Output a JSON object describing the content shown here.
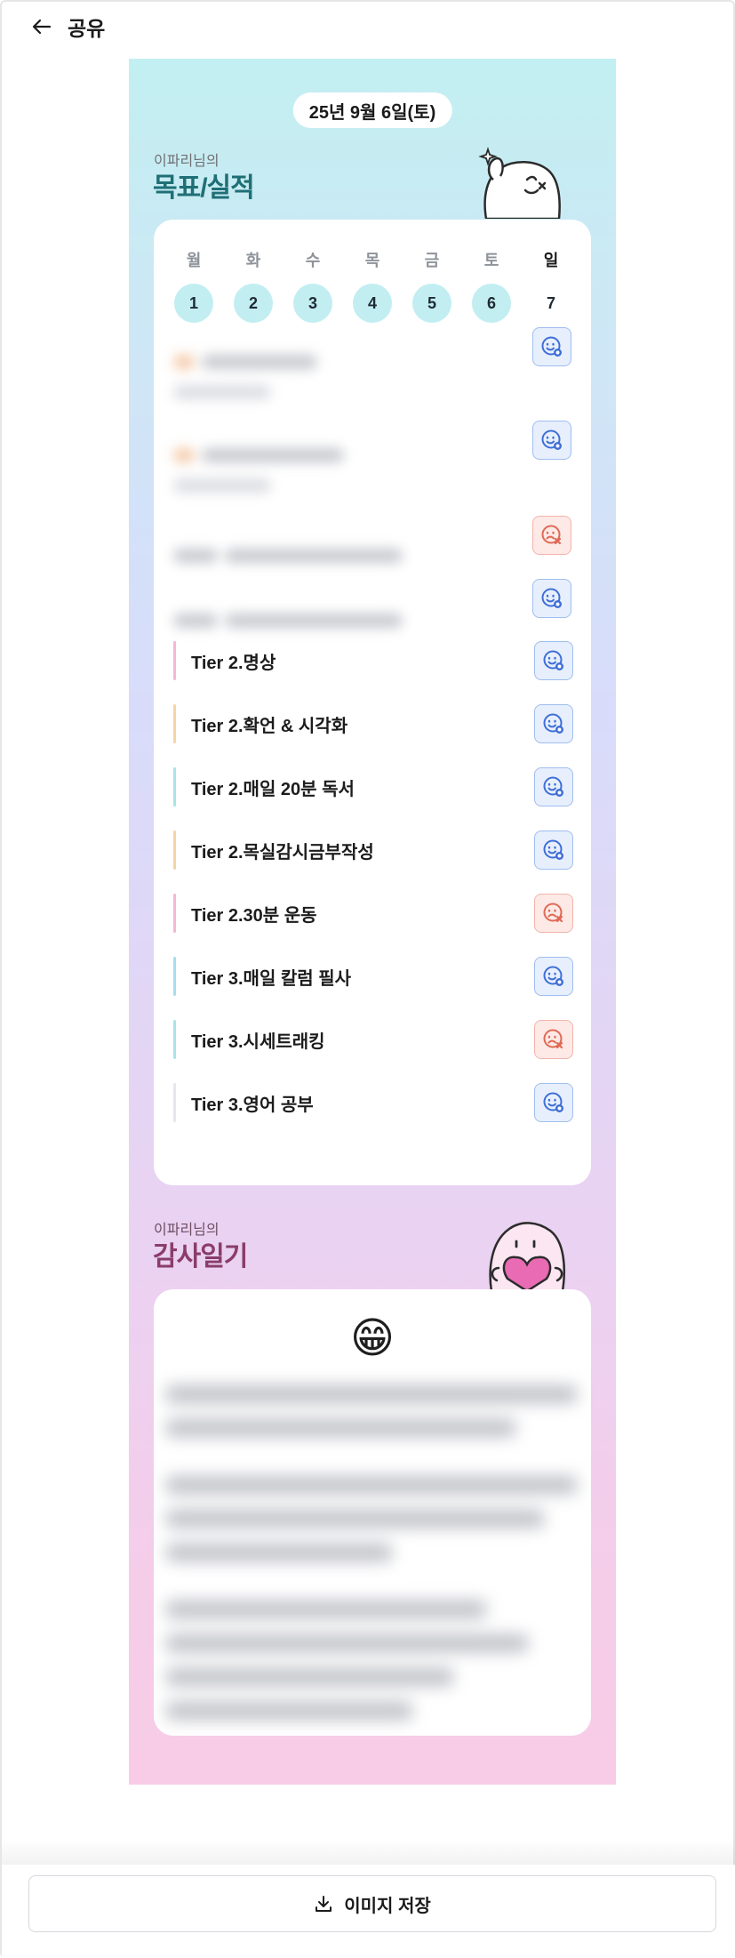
{
  "header": {
    "title": "공유",
    "back_icon": "arrow-left-icon"
  },
  "card": {
    "date": "25년 9월 6일(토)",
    "goals_section": {
      "subtitle": "이파리님의",
      "title": "목표/실적"
    },
    "week": [
      {
        "name": "월",
        "num": "1"
      },
      {
        "name": "화",
        "num": "2"
      },
      {
        "name": "수",
        "num": "3"
      },
      {
        "name": "목",
        "num": "4"
      },
      {
        "name": "금",
        "num": "5"
      },
      {
        "name": "토",
        "num": "6"
      },
      {
        "name": "일",
        "num": "7"
      }
    ],
    "hidden_goals_status": [
      "done",
      "done",
      "missed",
      "done"
    ],
    "goals": [
      {
        "label": "Tier 2.명상",
        "status": "done",
        "bar_color": "#f3b8d3"
      },
      {
        "label": "Tier 2.확언 & 시각화",
        "status": "done",
        "bar_color": "#f6d3a6"
      },
      {
        "label": "Tier 2.매일 20분 독서",
        "status": "done",
        "bar_color": "#a9e4e6"
      },
      {
        "label": "Tier 2.목실감시금부작성",
        "status": "done",
        "bar_color": "#f6d3a6"
      },
      {
        "label": "Tier 2.30분 운동",
        "status": "missed",
        "bar_color": "#f3b8d3"
      },
      {
        "label": "Tier 3.매일 칼럼 필사",
        "status": "done",
        "bar_color": "#a9dcef"
      },
      {
        "label": "Tier 3.시세트래킹",
        "status": "missed",
        "bar_color": "#a9e4e6"
      },
      {
        "label": "Tier 3.영어 공부",
        "status": "done",
        "bar_color": "#e6e6ee"
      }
    ],
    "diary_section": {
      "subtitle": "이파리님의",
      "title": "감사일기",
      "emoji": "😁"
    }
  },
  "footer": {
    "save_label": "이미지 저장",
    "save_icon": "download-icon"
  },
  "colors": {
    "goals_subtitle": "#6f6f72",
    "goals_title": "#1f6f76",
    "diary_subtitle": "#6f4e63",
    "diary_title": "#8a3d6a",
    "done_icon": "#3f6fd6",
    "missed_icon": "#df6a56",
    "day_highlight": "#c2eef2"
  }
}
